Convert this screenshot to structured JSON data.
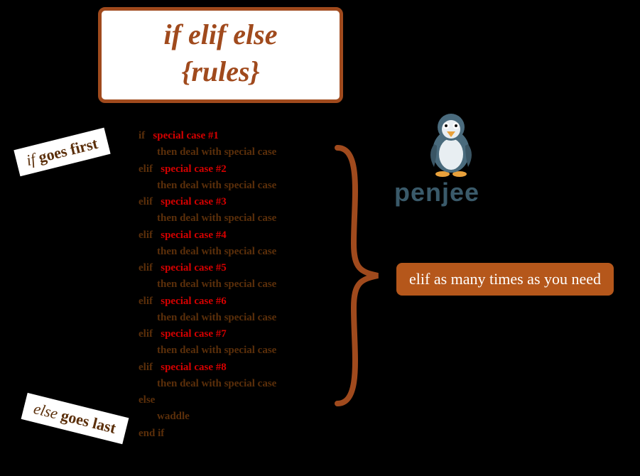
{
  "title": {
    "line1": "if   elif    else",
    "line2": "{rules}"
  },
  "labels": {
    "if_it": "if",
    "if_rest": " goes first",
    "else_it": "else",
    "else_rest": " goes last",
    "elif_note": "elif as many times as you need"
  },
  "logo": {
    "text": "penjee"
  },
  "code": {
    "kw_if": "if",
    "kw_elif": "elif",
    "kw_else": "else",
    "kw_endif": "end if",
    "action_deal": "then deal with special case",
    "action_waddle": "waddle",
    "cases": [
      "special case #1",
      "special case #2",
      "special case #3",
      "special case #4",
      "special case #5",
      "special case #6",
      "special case #7",
      "special case #8"
    ]
  }
}
